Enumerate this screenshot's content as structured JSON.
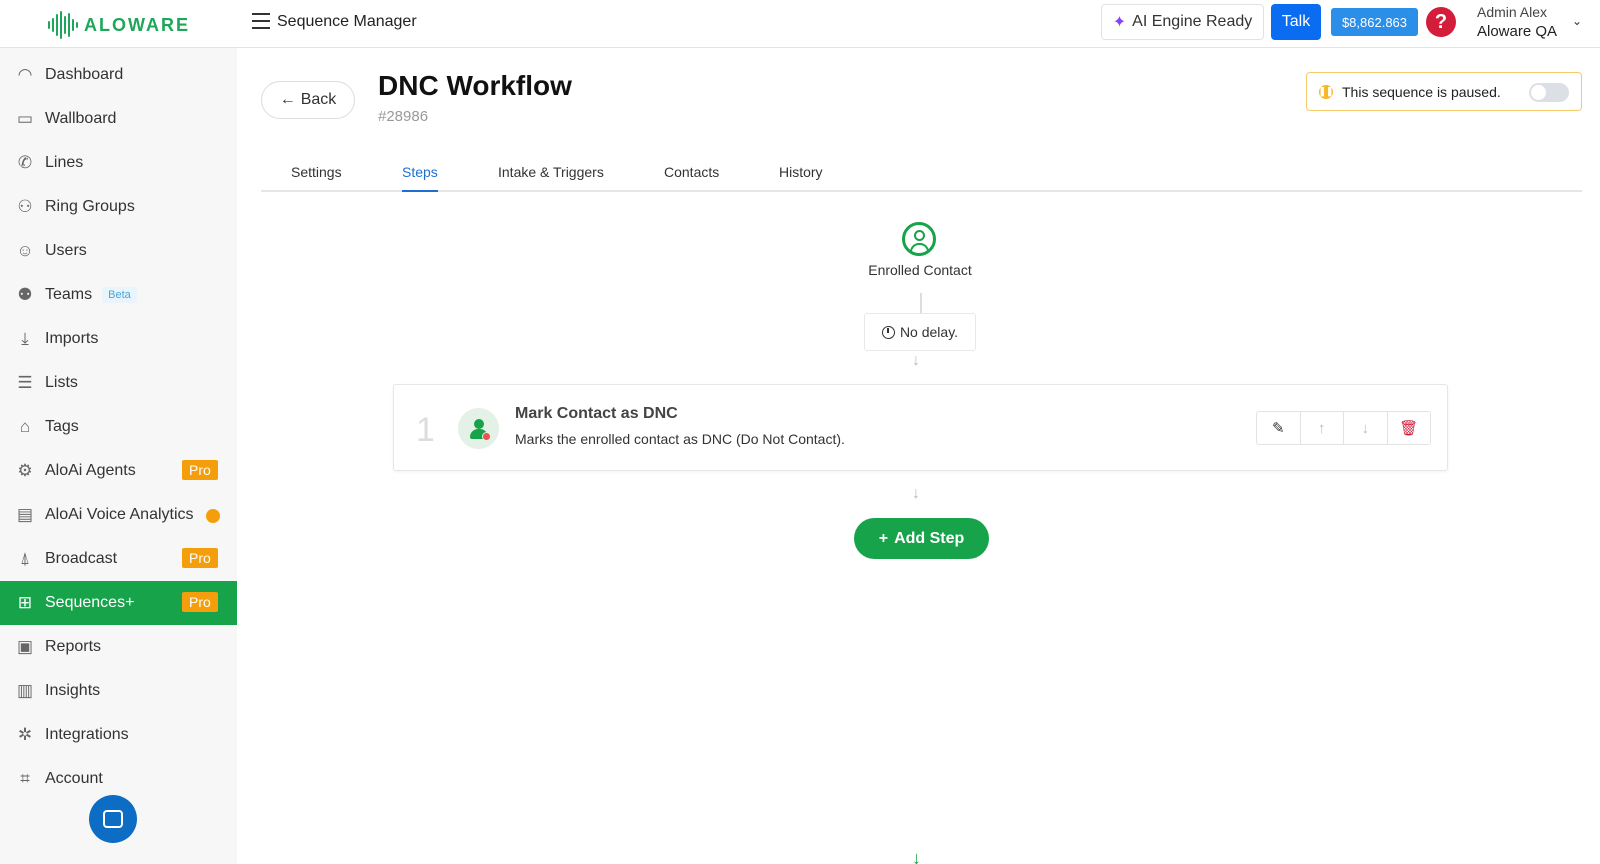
{
  "brand": {
    "name": "ALOWARE",
    "color": "#1ea75a"
  },
  "header": {
    "page_label": "Sequence Manager",
    "ai_engine": "AI Engine Ready",
    "talk_label": "Talk",
    "balance": "$8,862.863",
    "help_icon": "question-icon",
    "user_name": "Admin Alex",
    "user_org": "Aloware QA"
  },
  "sidebar": {
    "items": [
      {
        "label": "Dashboard",
        "icon": "dashboard-icon"
      },
      {
        "label": "Wallboard",
        "icon": "monitor-icon"
      },
      {
        "label": "Lines",
        "icon": "phone-icon"
      },
      {
        "label": "Ring Groups",
        "icon": "ring-groups-icon"
      },
      {
        "label": "Users",
        "icon": "user-icon"
      },
      {
        "label": "Teams",
        "icon": "teams-icon",
        "badge": "Beta"
      },
      {
        "label": "Imports",
        "icon": "import-icon"
      },
      {
        "label": "Lists",
        "icon": "list-icon"
      },
      {
        "label": "Tags",
        "icon": "tag-icon"
      },
      {
        "label": "AloAi Agents",
        "icon": "robot-icon",
        "badge": "Pro"
      },
      {
        "label": "AloAi Voice Analytics",
        "icon": "analytics-icon"
      },
      {
        "label": "Broadcast",
        "icon": "broadcast-icon",
        "badge": "Pro"
      },
      {
        "label": "Sequences+",
        "icon": "sequences-icon",
        "badge": "Pro"
      },
      {
        "label": "Reports",
        "icon": "reports-icon"
      },
      {
        "label": "Insights",
        "icon": "chart-icon"
      },
      {
        "label": "Integrations",
        "icon": "integrations-icon"
      },
      {
        "label": "Account",
        "icon": "account-icon"
      }
    ]
  },
  "main": {
    "back_label": "Back",
    "title": "DNC Workflow",
    "sequence_id": "#28986",
    "paused_text": "This sequence is paused.",
    "tabs": [
      {
        "label": "Settings"
      },
      {
        "label": "Steps"
      },
      {
        "label": "Intake & Triggers"
      },
      {
        "label": "Contacts"
      },
      {
        "label": "History"
      }
    ],
    "enrolled_label": "Enrolled Contact",
    "delay_label": "No delay.",
    "step": {
      "number": "1",
      "title": "Mark Contact as DNC",
      "description": "Marks the enrolled contact as DNC (Do Not Contact)."
    },
    "add_step_label": "Add Step"
  },
  "colors": {
    "accent_green": "#16a34a",
    "pro_badge": "#f59e0b",
    "talk_blue": "#0a6cf0",
    "delete_red": "#d31d3b"
  }
}
